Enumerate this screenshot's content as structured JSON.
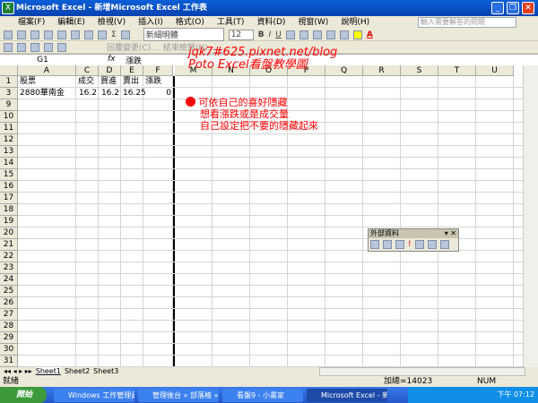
{
  "window": {
    "title": "Microsoft Excel - 新增Microsoft Excel 工作表"
  },
  "menu": [
    "檔案(F)",
    "編輯(E)",
    "檢視(V)",
    "插入(I)",
    "格式(O)",
    "工具(T)",
    "資料(D)",
    "視窗(W)",
    "說明(H)"
  ],
  "help_placeholder": "輸入需要解答的問題",
  "toolbar": {
    "font": "新細明體",
    "size": "12",
    "bold": "B",
    "italic": "I",
    "underline": "U",
    "sigma": "Σ",
    "reply_changes": "回覆變更(C)...",
    "end_review": "結束檢閱(N)..."
  },
  "formula": {
    "namebox": "G1",
    "fx": "fx",
    "value": "漲跌"
  },
  "watermark": [
    "jqk7#625.pixnet.net/blog",
    "Poto Excel看盤教學圖"
  ],
  "columns": [
    "A",
    "C",
    "D",
    "E",
    "F",
    "M",
    "N",
    "O",
    "P",
    "Q",
    "R",
    "S",
    "T",
    "U"
  ],
  "rows": [
    "1",
    "3",
    "9",
    "10",
    "11",
    "12",
    "13",
    "14",
    "15",
    "16",
    "17",
    "18",
    "19",
    "20",
    "21",
    "22",
    "23",
    "24",
    "25",
    "26",
    "27",
    "28",
    "29",
    "30",
    "31"
  ],
  "cells": {
    "r1": [
      "股票",
      "成交",
      "買進",
      "賣出",
      "漲跌"
    ],
    "r3": [
      "2880華南金",
      "16.2",
      "16.2",
      "16.25",
      "0"
    ]
  },
  "note": [
    "可依自己的喜好隱藏",
    "想看漲跌或是成交量",
    "自己設定把不要的隱藏起來"
  ],
  "external_data": {
    "title": "外部資料"
  },
  "sheets": [
    "Sheet1",
    "Sheet2",
    "Sheet3"
  ],
  "status": {
    "ready": "就緒",
    "sum": "加總=14023",
    "num": "NUM"
  },
  "taskbar": {
    "start": "開始",
    "items": [
      "Windows 工作管理員",
      "管理後台 » 部落格 »...",
      "看盤9 - 小畫家",
      "Microsoft Excel - 新..."
    ],
    "clock": "下午 07:12"
  }
}
